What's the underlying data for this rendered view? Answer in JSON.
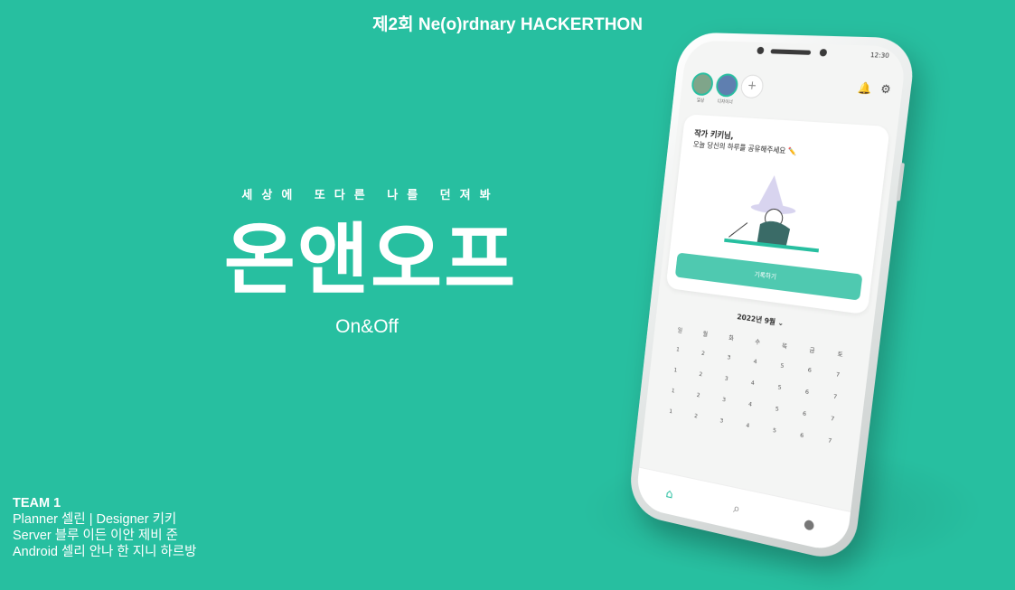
{
  "event_title": "제2회 Ne(o)rdnary HACKERTHON",
  "tagline": "세상에 또다른 나를 던져봐",
  "app_name_ko": "온앤오프",
  "app_name_en": "On&Off",
  "team": {
    "name": "TEAM 1",
    "line1": "Planner 셀린 | Designer 키키",
    "line2": "Server 블루 이든 이안 제비 준",
    "line3": "Android 셀리 안나 한 지니 하르방"
  },
  "colors": {
    "background": "#27bfa0",
    "accent": "#4fc9b0"
  },
  "phone": {
    "status_time": "12:30",
    "profiles": [
      {
        "label": "일상"
      },
      {
        "label": "디자이너"
      }
    ],
    "add_profile_glyph": "+",
    "greeting_line1": "작가 키키님,",
    "greeting_line2": "오늘 당신의 하루를 공유해주세요 ✏️",
    "record_button": "기록하기",
    "calendar_title": "2022년 9월 ⌄",
    "weekdays": [
      "일",
      "월",
      "화",
      "수",
      "목",
      "금",
      "토"
    ],
    "calendar_rows": [
      [
        "1",
        "2",
        "3",
        "4",
        "5",
        "6",
        "7"
      ],
      [
        "1",
        "2",
        "3",
        "4",
        "5",
        "6",
        "7"
      ],
      [
        "1",
        "2",
        "3",
        "4",
        "5",
        "6",
        "7"
      ],
      [
        "1",
        "2",
        "3",
        "4",
        "5",
        "6",
        "7"
      ]
    ],
    "tab_icons": [
      "home-icon",
      "search-icon",
      "profile-icon"
    ]
  }
}
